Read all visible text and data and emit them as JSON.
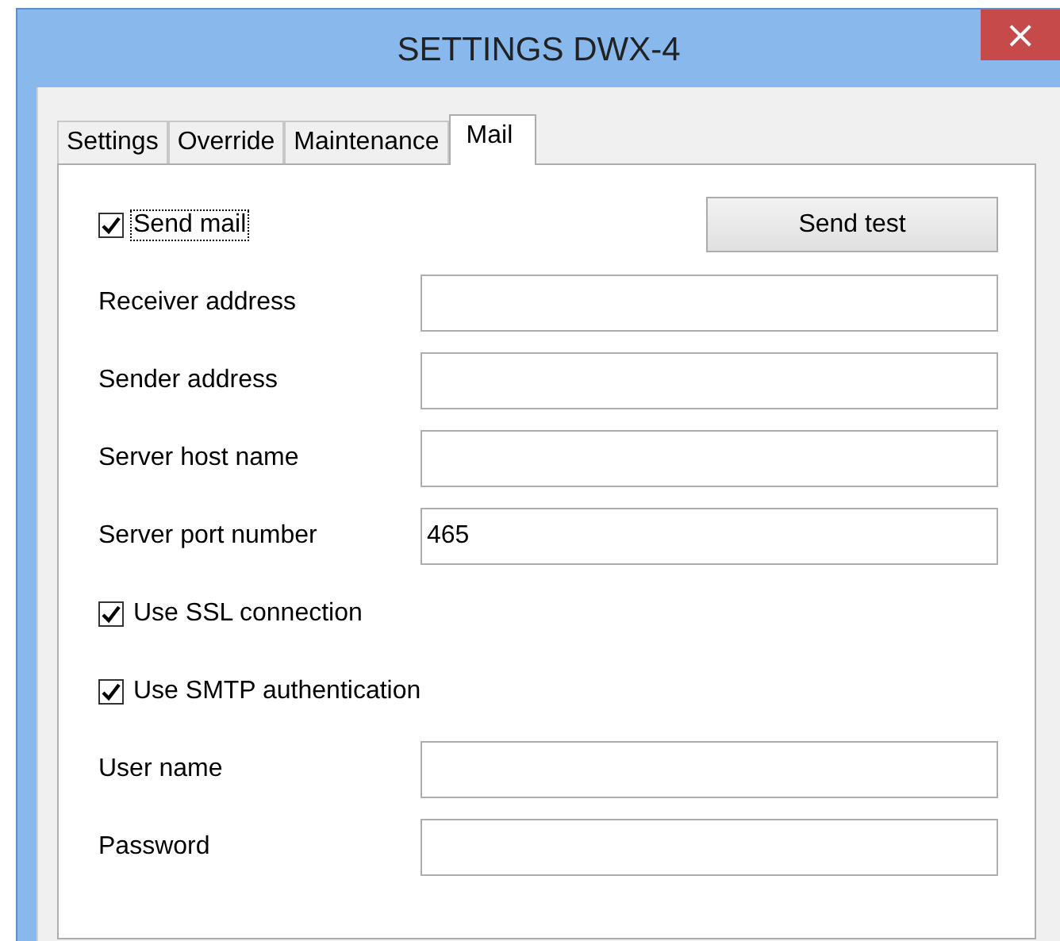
{
  "window": {
    "title": "SETTINGS DWX-4",
    "close": "×"
  },
  "tabs": [
    {
      "label": "Settings",
      "selected": false
    },
    {
      "label": "Override",
      "selected": false
    },
    {
      "label": "Maintenance",
      "selected": false
    },
    {
      "label": "Mail",
      "selected": true
    }
  ],
  "rows": [
    {
      "kind": "checkbox",
      "label": "Send mail",
      "checked": true,
      "focused": true,
      "button": "Send test"
    },
    {
      "kind": "field",
      "label": "Receiver address",
      "value": ""
    },
    {
      "kind": "field",
      "label": "Sender address",
      "value": ""
    },
    {
      "kind": "field",
      "label": "Server host name",
      "value": ""
    },
    {
      "kind": "field",
      "label": "Server port number",
      "value": "465"
    },
    {
      "kind": "checkbox",
      "label": "Use SSL connection",
      "checked": true,
      "focused": false
    },
    {
      "kind": "checkbox",
      "label": "Use SMTP authentication",
      "checked": true,
      "focused": false
    },
    {
      "kind": "field",
      "label": "User name",
      "value": ""
    },
    {
      "kind": "field",
      "label": "Password",
      "value": ""
    }
  ]
}
